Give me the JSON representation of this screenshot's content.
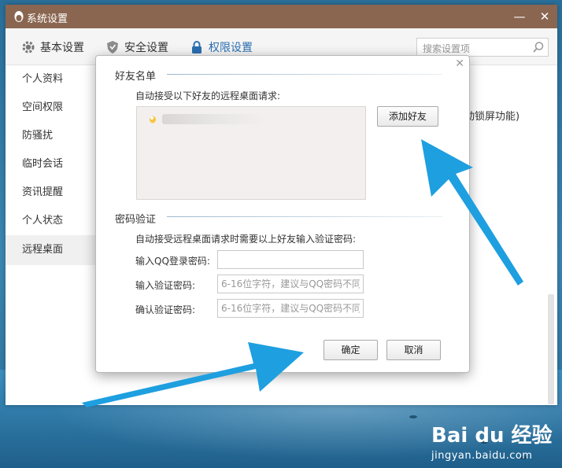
{
  "window": {
    "title": "系统设置",
    "minimize_label": "—",
    "close_label": "✕"
  },
  "tabs": [
    {
      "label": "基本设置",
      "icon": "gear-icon"
    },
    {
      "label": "安全设置",
      "icon": "shield-icon"
    },
    {
      "label": "权限设置",
      "icon": "lock-icon",
      "active": true
    }
  ],
  "search": {
    "placeholder": "搜索设置项"
  },
  "sidebar": {
    "items": [
      {
        "label": "个人资料"
      },
      {
        "label": "空间权限"
      },
      {
        "label": "防骚扰"
      },
      {
        "label": "临时会话"
      },
      {
        "label": "资讯提醒"
      },
      {
        "label": "个人状态"
      },
      {
        "label": "远程桌面",
        "active": true
      }
    ]
  },
  "background_text": "动锁屏功能)",
  "dialog": {
    "close_label": "✕",
    "friends_section": {
      "title": "好友名单",
      "description": "自动接受以下好友的远程桌面请求:",
      "add_button": "添加好友"
    },
    "password_section": {
      "title": "密码验证",
      "description": "自动接受远程桌面请求时需要以上好友输入验证密码:",
      "fields": [
        {
          "label": "输入QQ登录密码:",
          "value": "",
          "placeholder": ""
        },
        {
          "label": "输入验证密码:",
          "value": "",
          "placeholder": "6-16位字符，建议与QQ密码不同"
        },
        {
          "label": "确认验证密码:",
          "value": "",
          "placeholder": "6-16位字符，建议与QQ密码不同"
        }
      ]
    },
    "ok_button": "确定",
    "cancel_button": "取消"
  },
  "watermark": {
    "brand": "Bai du 经验",
    "url": "jingyan.baidu.com"
  },
  "colors": {
    "titlebar": "#8a6650",
    "accent": "#2a6fb0",
    "arrow": "#1e9fe0"
  }
}
